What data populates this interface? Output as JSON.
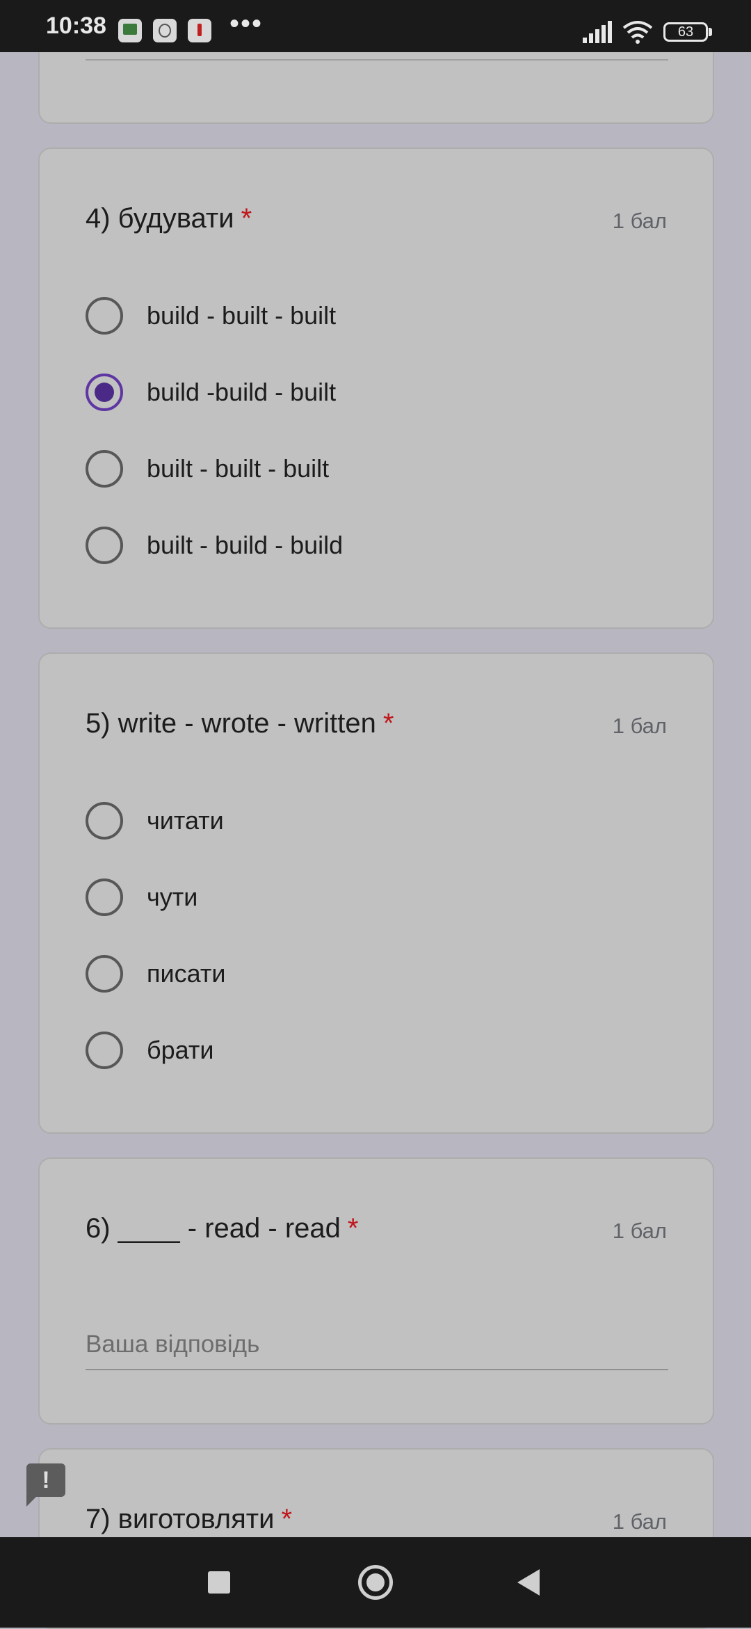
{
  "status_bar": {
    "time": "10:38",
    "battery": "63",
    "more": "•••"
  },
  "questions": [
    {
      "title": "4) будувати",
      "required": "*",
      "points": "1 бал",
      "options": [
        {
          "label": "build - built - built",
          "selected": false
        },
        {
          "label": "build -build - built",
          "selected": true
        },
        {
          "label": "built - built - built",
          "selected": false
        },
        {
          "label": "built - build - build",
          "selected": false
        }
      ]
    },
    {
      "title": "5) write - wrote - written",
      "required": "*",
      "points": "1 бал",
      "options": [
        {
          "label": "читати",
          "selected": false
        },
        {
          "label": "чути",
          "selected": false
        },
        {
          "label": "писати",
          "selected": false
        },
        {
          "label": "брати",
          "selected": false
        }
      ]
    },
    {
      "title": "6) ____ - read - read",
      "required": "*",
      "points": "1 бал",
      "answer_placeholder": "Ваша відповідь"
    },
    {
      "title": "7) виготовляти",
      "required": "*",
      "points": "1 бал"
    }
  ],
  "feedback": {
    "symbol": "!"
  },
  "colors": {
    "accent": "#5e35a3",
    "required": "#c0171c",
    "card_bg": "#c1c1c1",
    "page_bg": "#b8b6c0"
  }
}
